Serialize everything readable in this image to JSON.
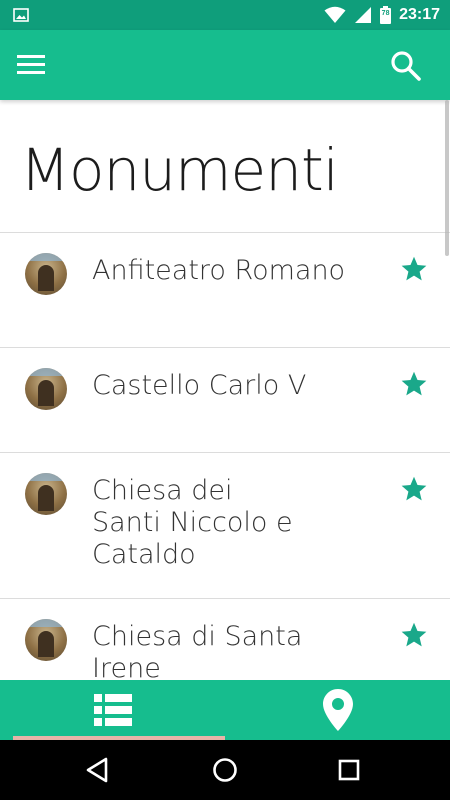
{
  "status_bar": {
    "time": "23:17",
    "battery_level": "78",
    "icons": [
      "image-notification-icon",
      "wifi-icon",
      "cellular-signal-icon",
      "battery-icon"
    ]
  },
  "app_bar": {
    "menu_icon": "hamburger-menu-icon",
    "search_icon": "search-icon",
    "color": "#16bd8e"
  },
  "page": {
    "title": "Monumenti"
  },
  "monuments": [
    {
      "name": "Anfiteatro Romano",
      "favorite": true
    },
    {
      "name": "Castello Carlo V",
      "favorite": true
    },
    {
      "name": "Chiesa dei Santi Niccolo e Cataldo",
      "favorite": true
    },
    {
      "name": "Chiesa di Santa Irene",
      "favorite": true
    }
  ],
  "bottom_tabs": [
    {
      "icon": "list-icon",
      "selected": true
    },
    {
      "icon": "map-pin-icon",
      "selected": false
    }
  ],
  "nav_bar": {
    "buttons": [
      "back-icon",
      "home-icon",
      "recents-icon"
    ]
  },
  "colors": {
    "status_bar": "#0f9e7b",
    "accent": "#16bd8e",
    "star": "#1aa88a",
    "tab_indicator": "#e8b4a8"
  }
}
